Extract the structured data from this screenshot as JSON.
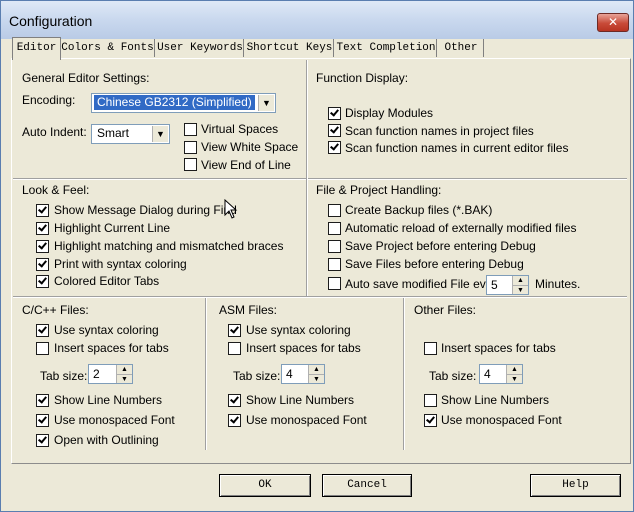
{
  "window": {
    "title": "Configuration",
    "close_glyph": "✕"
  },
  "tabs": [
    {
      "label": "Editor",
      "active": true
    },
    {
      "label": "Colors & Fonts"
    },
    {
      "label": "User Keywords"
    },
    {
      "label": "Shortcut Keys"
    },
    {
      "label": "Text Completion"
    },
    {
      "label": "Other"
    }
  ],
  "general": {
    "heading": "General Editor Settings:",
    "encoding_label": "Encoding:",
    "encoding_value": "Chinese GB2312 (Simplified)",
    "indent_label": "Auto Indent:",
    "indent_value": "Smart",
    "virtual_spaces": {
      "label": "Virtual Spaces",
      "checked": false
    },
    "white_space": {
      "label": "View White Space",
      "checked": false
    },
    "end_of_line": {
      "label": "View End of Line",
      "checked": false
    }
  },
  "function_display": {
    "heading": "Function Display:",
    "items": [
      {
        "label": "Display Modules",
        "checked": true
      },
      {
        "label": "Scan function names in project files",
        "checked": true
      },
      {
        "label": "Scan function names in current editor files",
        "checked": true
      }
    ]
  },
  "look_feel": {
    "heading": "Look & Feel:",
    "items": [
      {
        "label": "Show Message Dialog during Find",
        "checked": true
      },
      {
        "label": "Highlight Current Line",
        "checked": true
      },
      {
        "label": "Highlight matching and mismatched braces",
        "checked": true
      },
      {
        "label": "Print with syntax coloring",
        "checked": true
      },
      {
        "label": "Colored Editor Tabs",
        "checked": true
      }
    ]
  },
  "file_project": {
    "heading": "File & Project Handling:",
    "items": [
      {
        "label": "Create Backup files (*.BAK)",
        "checked": false
      },
      {
        "label": "Automatic reload of externally modified files",
        "checked": false
      },
      {
        "label": "Save Project before entering Debug",
        "checked": false
      },
      {
        "label": "Save Files before entering Debug",
        "checked": false
      },
      {
        "label": "Auto save modified File every",
        "checked": false
      }
    ],
    "autosave_value": "5",
    "autosave_unit": "Minutes."
  },
  "c_files": {
    "heading": "C/C++ Files:",
    "syntax": {
      "label": "Use syntax coloring",
      "checked": true
    },
    "spaces": {
      "label": "Insert spaces for tabs",
      "checked": false
    },
    "tab_label": "Tab size:",
    "tab_value": "2",
    "line_numbers": {
      "label": "Show Line Numbers",
      "checked": true
    },
    "mono": {
      "label": "Use monospaced Font",
      "checked": true
    },
    "outlining": {
      "label": "Open with Outlining",
      "checked": true
    }
  },
  "asm_files": {
    "heading": "ASM Files:",
    "syntax": {
      "label": "Use syntax coloring",
      "checked": true
    },
    "spaces": {
      "label": "Insert spaces for tabs",
      "checked": false
    },
    "tab_label": "Tab size:",
    "tab_value": "4",
    "line_numbers": {
      "label": "Show Line Numbers",
      "checked": true
    },
    "mono": {
      "label": "Use monospaced Font",
      "checked": true
    }
  },
  "other_files": {
    "heading": "Other Files:",
    "spaces": {
      "label": "Insert spaces for tabs",
      "checked": false
    },
    "tab_label": "Tab size:",
    "tab_value": "4",
    "line_numbers": {
      "label": "Show Line Numbers",
      "checked": false
    },
    "mono": {
      "label": "Use monospaced Font",
      "checked": true
    }
  },
  "buttons": {
    "ok": "OK",
    "cancel": "Cancel",
    "help": "Help"
  }
}
